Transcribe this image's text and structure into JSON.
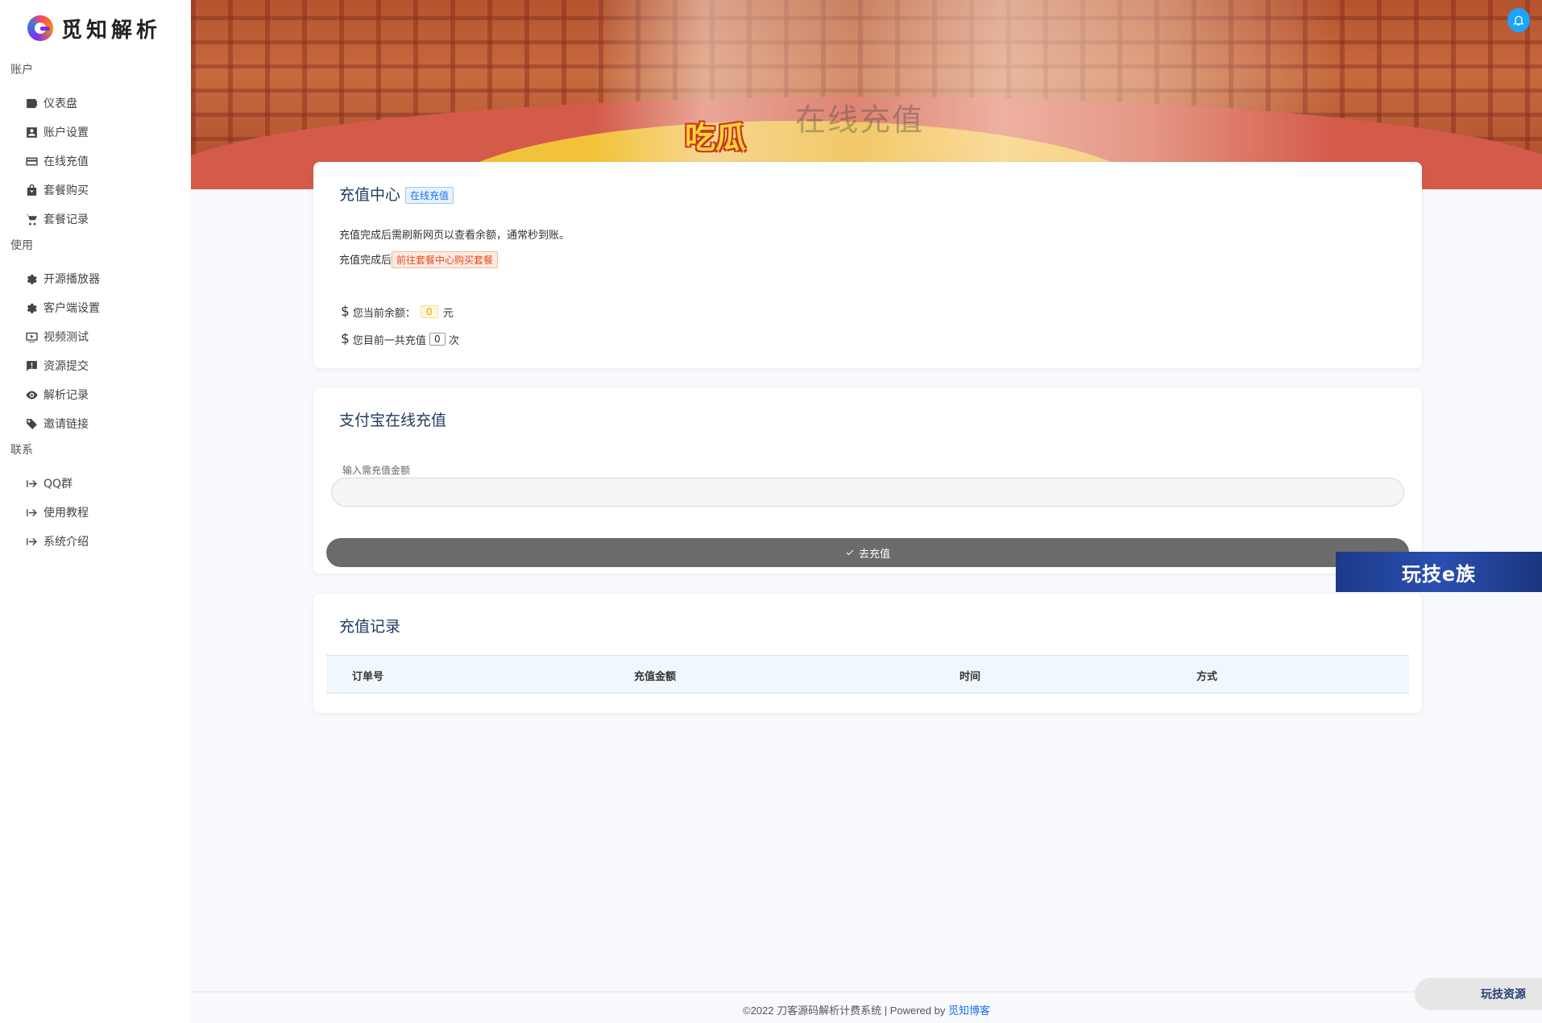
{
  "app": {
    "logo_text": "觅知解析"
  },
  "sidebar": {
    "sections": [
      {
        "title": "账户",
        "items": [
          {
            "label": "仪表盘",
            "icon": "wallet-icon"
          },
          {
            "label": "账户设置",
            "icon": "account-box-icon"
          },
          {
            "label": "在线充值",
            "icon": "credit-card-icon"
          },
          {
            "label": "套餐购买",
            "icon": "shopping-bag-icon"
          },
          {
            "label": "套餐记录",
            "icon": "cart-icon"
          }
        ]
      },
      {
        "title": "使用",
        "items": [
          {
            "label": "开源播放器",
            "icon": "gear-icon"
          },
          {
            "label": "客户端设置",
            "icon": "gear-icon"
          },
          {
            "label": "视频测试",
            "icon": "play-box-icon"
          },
          {
            "label": "资源提交",
            "icon": "alert-box-icon"
          },
          {
            "label": "解析记录",
            "icon": "eye-icon"
          },
          {
            "label": "邀请链接",
            "icon": "tag-icon"
          }
        ]
      },
      {
        "title": "联系",
        "items": [
          {
            "label": "QQ群",
            "icon": "arrow-to-icon"
          },
          {
            "label": "使用教程",
            "icon": "arrow-to-icon"
          },
          {
            "label": "系统介绍",
            "icon": "arrow-to-icon"
          }
        ]
      }
    ]
  },
  "banner": {
    "logo_text": "吃瓜",
    "overlay_text": "在线充值"
  },
  "recharge_center": {
    "title": "充值中心",
    "tag": "在线充值",
    "note1": "充值完成后需刷新网页以查看余额，通常秒到账。",
    "note2_prefix": "充值完成后",
    "note2_link": "前往套餐中心购买套餐",
    "balance_label": "您当前余额：",
    "balance_value": "0",
    "balance_unit": "元",
    "count_label": "您目前一共充值",
    "count_value": "0",
    "count_unit": "次"
  },
  "alipay": {
    "title": "支付宝在线充值",
    "input_label": "输入需充值金额",
    "input_value": "",
    "input_placeholder": "",
    "submit_label": "去充值"
  },
  "records": {
    "title": "充值记录",
    "columns": [
      "订单号",
      "充值金额",
      "时间",
      "方式"
    ],
    "rows": []
  },
  "float_ad": {
    "text": "玩技e族"
  },
  "footer": {
    "text": "©2022 刀客源码解析计费系统 | Powered by ",
    "link": "觅知博客"
  },
  "corner_badge": {
    "text": "玩技资源"
  },
  "colors": {
    "primary_text": "#1f3a5f",
    "submit_button": "#6b6b6b",
    "link": "#1a73e8",
    "ad_bg": "#1d3a8a"
  }
}
